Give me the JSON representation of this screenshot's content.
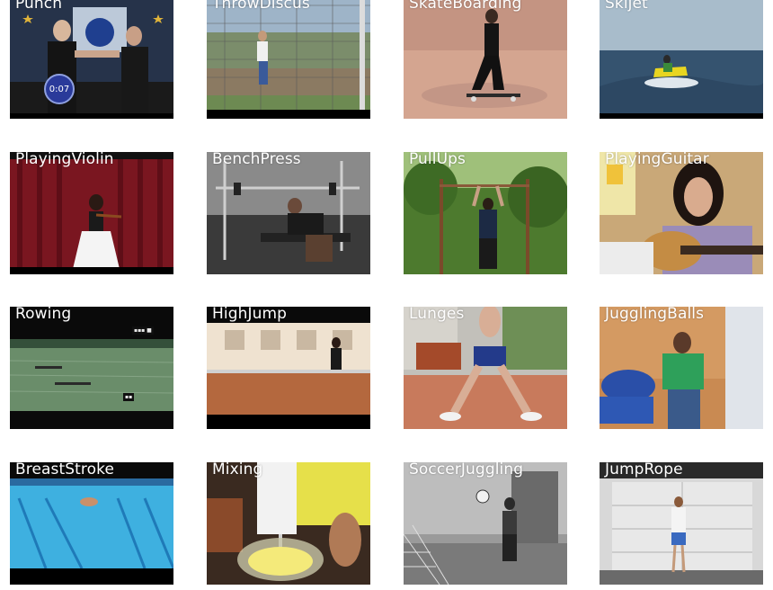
{
  "tiles": [
    {
      "label": "Punch"
    },
    {
      "label": "ThrowDiscus"
    },
    {
      "label": "SkateBoarding"
    },
    {
      "label": "Skijet"
    },
    {
      "label": "PlayingViolin"
    },
    {
      "label": "BenchPress"
    },
    {
      "label": "PullUps"
    },
    {
      "label": "PlayingGuitar"
    },
    {
      "label": "Rowing"
    },
    {
      "label": "HighJump"
    },
    {
      "label": "Lunges"
    },
    {
      "label": "JugglingBalls"
    },
    {
      "label": "BreastStroke"
    },
    {
      "label": "Mixing"
    },
    {
      "label": "SoccerJuggling"
    },
    {
      "label": "JumpRope"
    }
  ],
  "overlays": {
    "punch_timer": "0:07"
  }
}
